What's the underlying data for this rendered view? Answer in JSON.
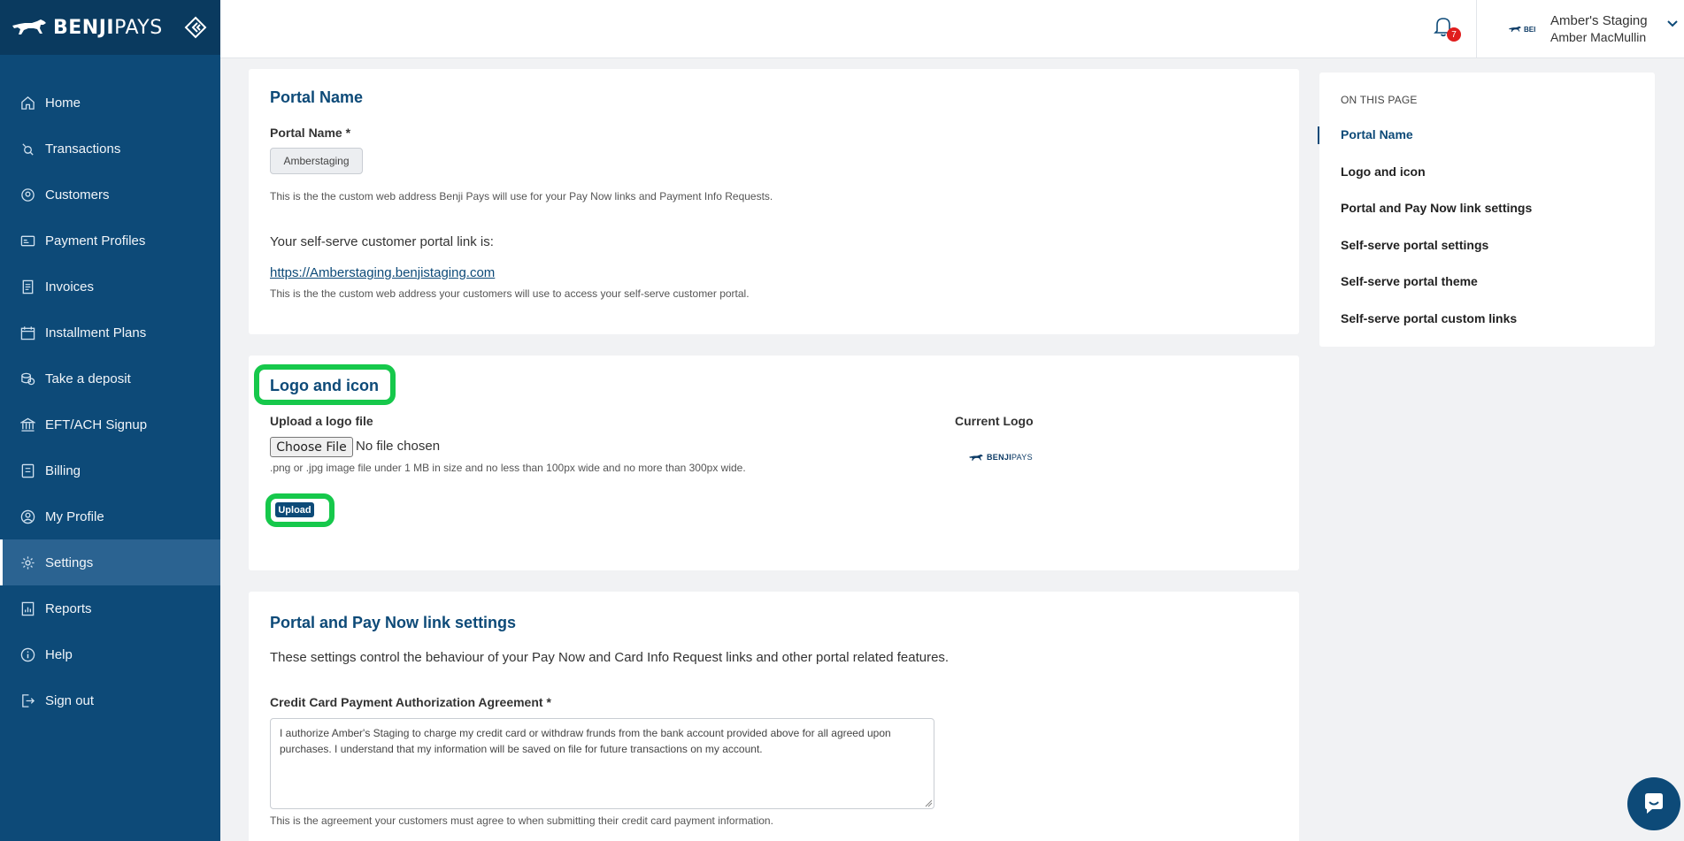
{
  "brand": {
    "bold": "BENJI",
    "light": "PAYS"
  },
  "nav": [
    {
      "label": "Home",
      "icon": "home-icon"
    },
    {
      "label": "Transactions",
      "icon": "transactions-icon"
    },
    {
      "label": "Customers",
      "icon": "customers-icon"
    },
    {
      "label": "Payment Profiles",
      "icon": "payment-profiles-icon"
    },
    {
      "label": "Invoices",
      "icon": "invoices-icon"
    },
    {
      "label": "Installment Plans",
      "icon": "calendar-icon"
    },
    {
      "label": "Take a deposit",
      "icon": "coins-icon"
    },
    {
      "label": "EFT/ACH Signup",
      "icon": "bank-icon"
    },
    {
      "label": "Billing",
      "icon": "billing-icon"
    },
    {
      "label": "My Profile",
      "icon": "profile-icon"
    },
    {
      "label": "Settings",
      "icon": "gear-icon",
      "active": true
    },
    {
      "label": "Reports",
      "icon": "reports-icon"
    },
    {
      "label": "Help",
      "icon": "help-icon"
    },
    {
      "label": "Sign out",
      "icon": "sign-out-icon"
    }
  ],
  "topbar": {
    "notification_count": "7",
    "company": "Amber's Staging",
    "user": "Amber MacMullin",
    "logo_text": "BEI"
  },
  "portal_name": {
    "title": "Portal Name",
    "field_label": "Portal Name *",
    "value": "Amberstaging",
    "help1": "This is the the custom web address Benji Pays will use for your Pay Now links and Payment Info Requests.",
    "link_intro": "Your self-serve customer portal link is:",
    "link": "https://Amberstaging.benjistaging.com",
    "help2": "This is the the custom web address your customers will use to access your self-serve customer portal."
  },
  "logo_icon": {
    "title": "Logo and icon",
    "upload_label": "Upload a logo file",
    "choose_button": "Choose File",
    "file_status": "No file chosen",
    "help": ".png or .jpg image file under 1 MB in size and no less than 100px wide and no more than 300px wide.",
    "upload_button": "Upload",
    "current_label": "Current Logo",
    "current_logo_bold": "BENJI",
    "current_logo_light": "PAYS"
  },
  "portal_settings": {
    "title": "Portal and Pay Now link settings",
    "description": "These settings control the behaviour of your Pay Now and Card Info Request links and other portal related features.",
    "agreement_label": "Credit Card Payment Authorization Agreement *",
    "agreement_text": "I authorize Amber's Staging to charge my credit card or withdraw frunds from the bank account provided above for all agreed upon purchases. I understand that my information will be saved on file for future transactions on my account.",
    "agreement_help": "This is the agreement your customers must agree to when submitting their credit card payment information."
  },
  "toc": {
    "heading": "ON THIS PAGE",
    "items": [
      "Portal Name",
      "Logo and icon",
      "Portal and Pay Now link settings",
      "Self-serve portal settings",
      "Self-serve portal theme",
      "Self-serve portal custom links"
    ]
  },
  "colors": {
    "sidebar": "#0d4a78",
    "brand_bar": "#0a3a5f",
    "accent": "#0d4a78",
    "highlight": "#16c84b",
    "badge": "#e01e1e"
  }
}
